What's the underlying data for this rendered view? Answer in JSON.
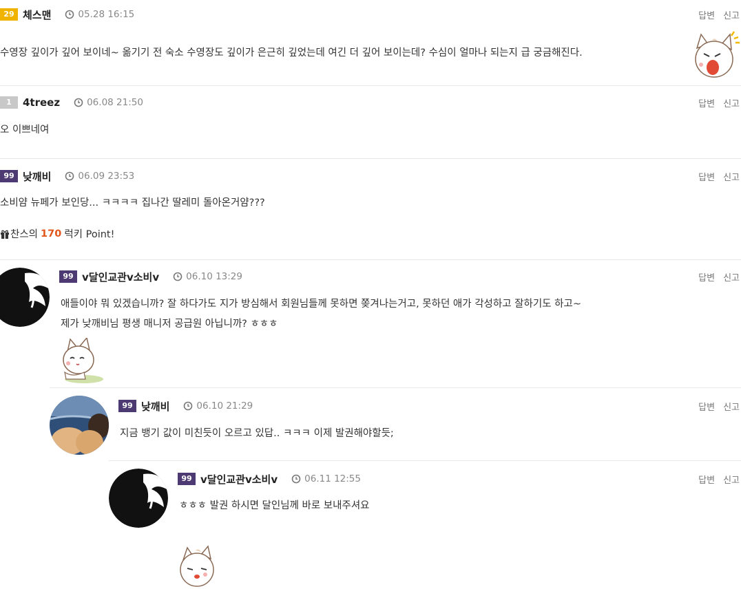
{
  "actions": {
    "reply": "답변",
    "report": "신고"
  },
  "comments": [
    {
      "level": "29",
      "level_color": "#f0b400",
      "nick": "체스맨",
      "time": "05.28 16:15",
      "text": "수영장 깊이가 깊어 보이네~ 옮기기 전 숙소 수영장도 깊이가 은근히 깊었는데 여긴 더 깊어 보이는데? 수심이 얼마나 되는지 급 궁금해진다."
    },
    {
      "level": "1",
      "level_color": "#c8c8c8",
      "nick": "4treez",
      "time": "06.08 21:50",
      "text": "오 이쁘네여"
    },
    {
      "level": "99",
      "level_color": "#4e3a72",
      "nick": "낮깨비",
      "time": "06.09 23:53",
      "text": "소비얌 뉴페가 보인당... ㅋㅋㅋㅋ 집나간 딸레미 돌아온거얌???",
      "lucky": {
        "prefix": "찬스의",
        "points": "170",
        "suffix": "럭키 Point!"
      }
    },
    {
      "level": "99",
      "level_color": "#4e3a72",
      "nick": "v달인교관v소비v",
      "time": "06.10 13:29",
      "lines": [
        "애들이야 뭐 있겠습니까? 잘 하다가도 지가 방심해서 회원님들께 못하면 쫒겨나는거고, 못하던 애가 각성하고 잘하기도 하고~",
        "제가 낮깨비님 평생 매니저 공급원 아닙니까? ㅎㅎㅎ"
      ]
    },
    {
      "level": "99",
      "level_color": "#4e3a72",
      "nick": "낮깨비",
      "time": "06.10 21:29",
      "text": "지금 뱅기 값이 미친듯이 오르고 있답.. ㅋㅋㅋ 이제 발권해야할듯;"
    },
    {
      "level": "99",
      "level_color": "#4e3a72",
      "nick": "v달인교관v소비v",
      "time": "06.11 12:55",
      "text": "ㅎㅎㅎ 발권 하시면 달인님께 바로 보내주셔요"
    }
  ]
}
